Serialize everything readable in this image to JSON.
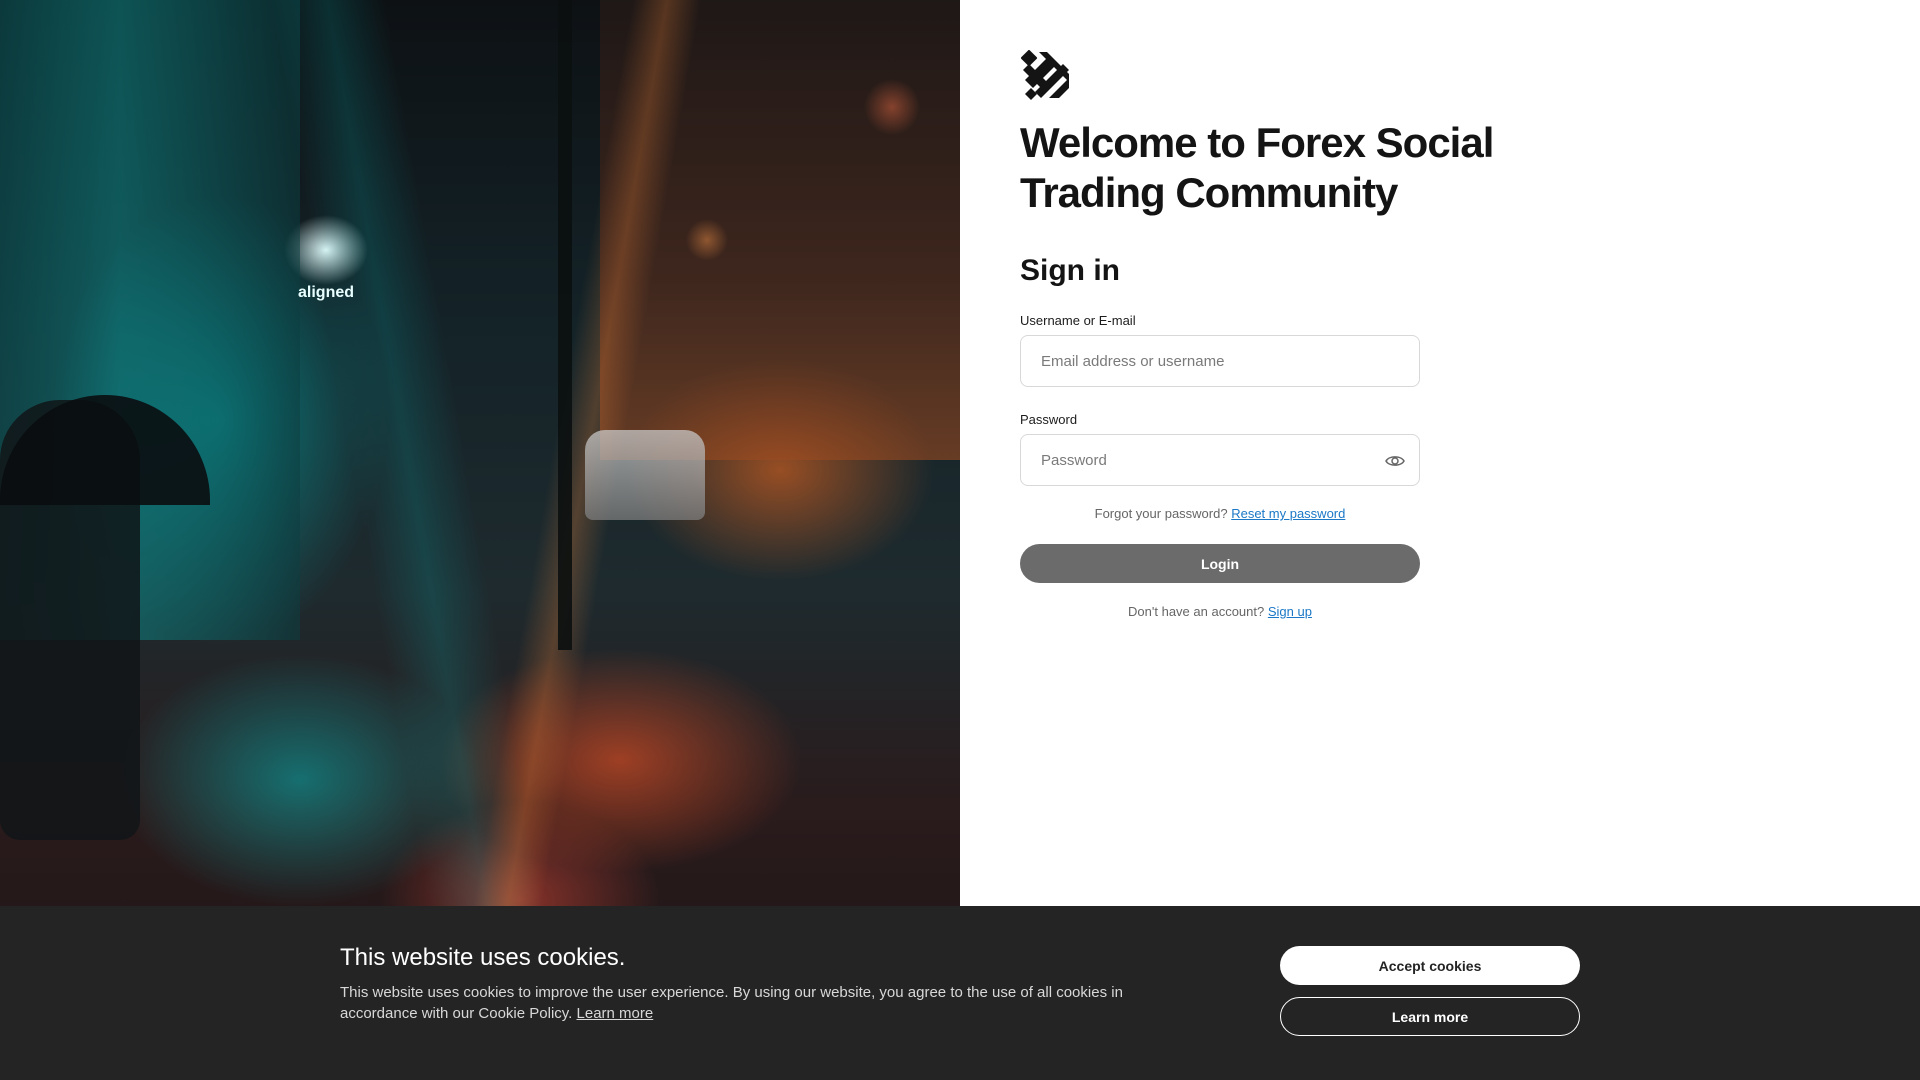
{
  "photo": {
    "sign_text": "aligned"
  },
  "login": {
    "welcome_line1": "Welcome to Forex Social",
    "welcome_line2": "Trading Community",
    "title": "Sign in",
    "username_label": "Username or E-mail",
    "username_placeholder": "Email address or username",
    "password_label": "Password",
    "password_placeholder": "Password",
    "forgot_text": "Forgot your password?",
    "reset_link": "Reset my password",
    "login_button": "Login",
    "no_account_text": "Don't have an account?",
    "signup_link": "Sign up"
  },
  "cookie_banner": {
    "title": "This website uses cookies.",
    "body": "This website uses cookies to improve the user experience. By using our website, you agree to the use of all cookies in accordance with our Cookie Policy.",
    "body_link": "Learn more",
    "accept_button": "Accept cookies",
    "learn_more_button": "Learn more"
  },
  "colors": {
    "login_button_bg": "#6b6b6b",
    "link": "#1b78c6",
    "banner_bg": "#242424"
  },
  "icons": {
    "logo": "brand-logo-icon",
    "password_toggle": "eye-icon"
  }
}
